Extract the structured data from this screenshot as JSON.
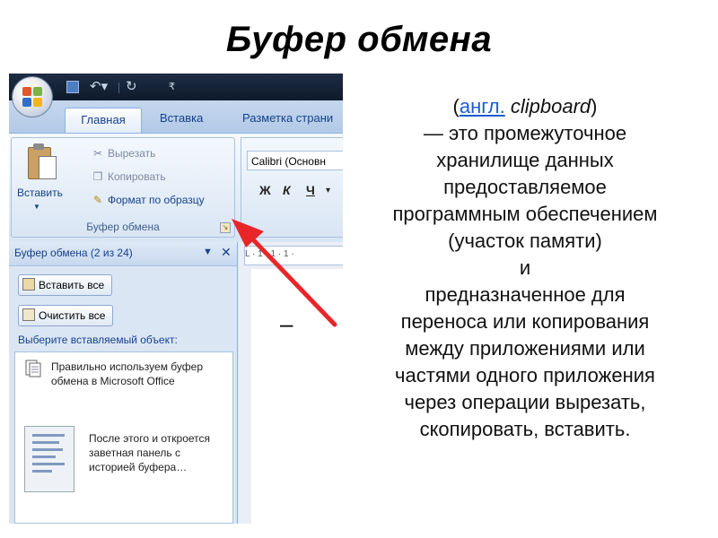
{
  "slide": {
    "title": "Буфер обмена"
  },
  "office": {
    "tabs": {
      "home": "Главная",
      "insert": "Вставка",
      "layout": "Разметка страни"
    },
    "clipboard_group": {
      "paste": "Вставить",
      "cut": "Вырезать",
      "copy": "Копировать",
      "format_painter": "Формат по образцу",
      "label": "Буфер обмена"
    },
    "font_group": {
      "font_name": "Calibri (Основн",
      "bold": "Ж",
      "italic": "К",
      "underline": "Ч"
    },
    "task_pane": {
      "title": "Буфер обмена (2 из 24)",
      "paste_all": "Вставить все",
      "clear_all": "Очистить все",
      "prompt": "Выберите вставляемый объект:",
      "items": [
        "Правильно используем буфер обмена в Microsoft Office",
        "После этого и откроется заветная панель с историей буфера…"
      ]
    },
    "ruler_text": "L · 1 · 1 · 1 ·",
    "dash": "–"
  },
  "definition": {
    "open_paren": "(",
    "lang_link": "англ.",
    "term": " clipboard",
    "close_paren": ")",
    "lines": [
      "— это промежуточное",
      "хранилище данных",
      "предоставляемое",
      "программным обеспечением",
      "(участок памяти)",
      "и",
      "предназначенное для",
      "переноса или копирования",
      "между приложениями или",
      "частями одного приложения",
      "через операции вырезать,",
      "скопировать, вставить."
    ]
  },
  "colors": {
    "arrow": "#e8262a",
    "link": "#1d5bd0",
    "ribbon_text": "#15428b"
  }
}
